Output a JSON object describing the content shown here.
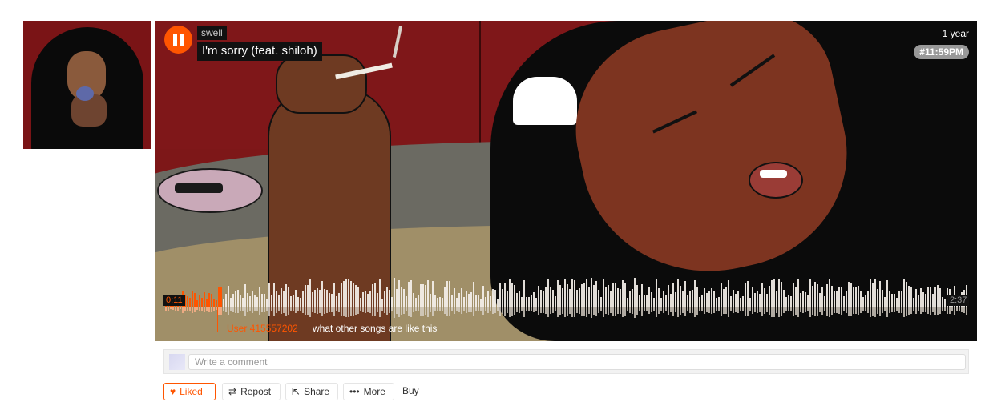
{
  "track": {
    "artist": "swell",
    "title": "I'm sorry  (feat. shiloh)",
    "posted": "1 year",
    "tag": "#11:59PM",
    "artwork_icon": "album-artwork",
    "cover_icon": "cover-art-illustration"
  },
  "player": {
    "state_icon": "pause-icon",
    "progress": 0.07,
    "current_time": "0:11",
    "duration": "2:37",
    "accent": "#ff5500"
  },
  "waveform_comment": {
    "user": "User 415557202",
    "text": "what other songs are like this"
  },
  "comment": {
    "placeholder": "Write a comment"
  },
  "actions": {
    "liked": "Liked",
    "repost": "Repost",
    "share": "Share",
    "more": "More",
    "buy": "Buy",
    "liked_icon": "heart-icon",
    "repost_icon": "repost-icon",
    "share_icon": "share-icon",
    "more_icon": "more-icon"
  }
}
